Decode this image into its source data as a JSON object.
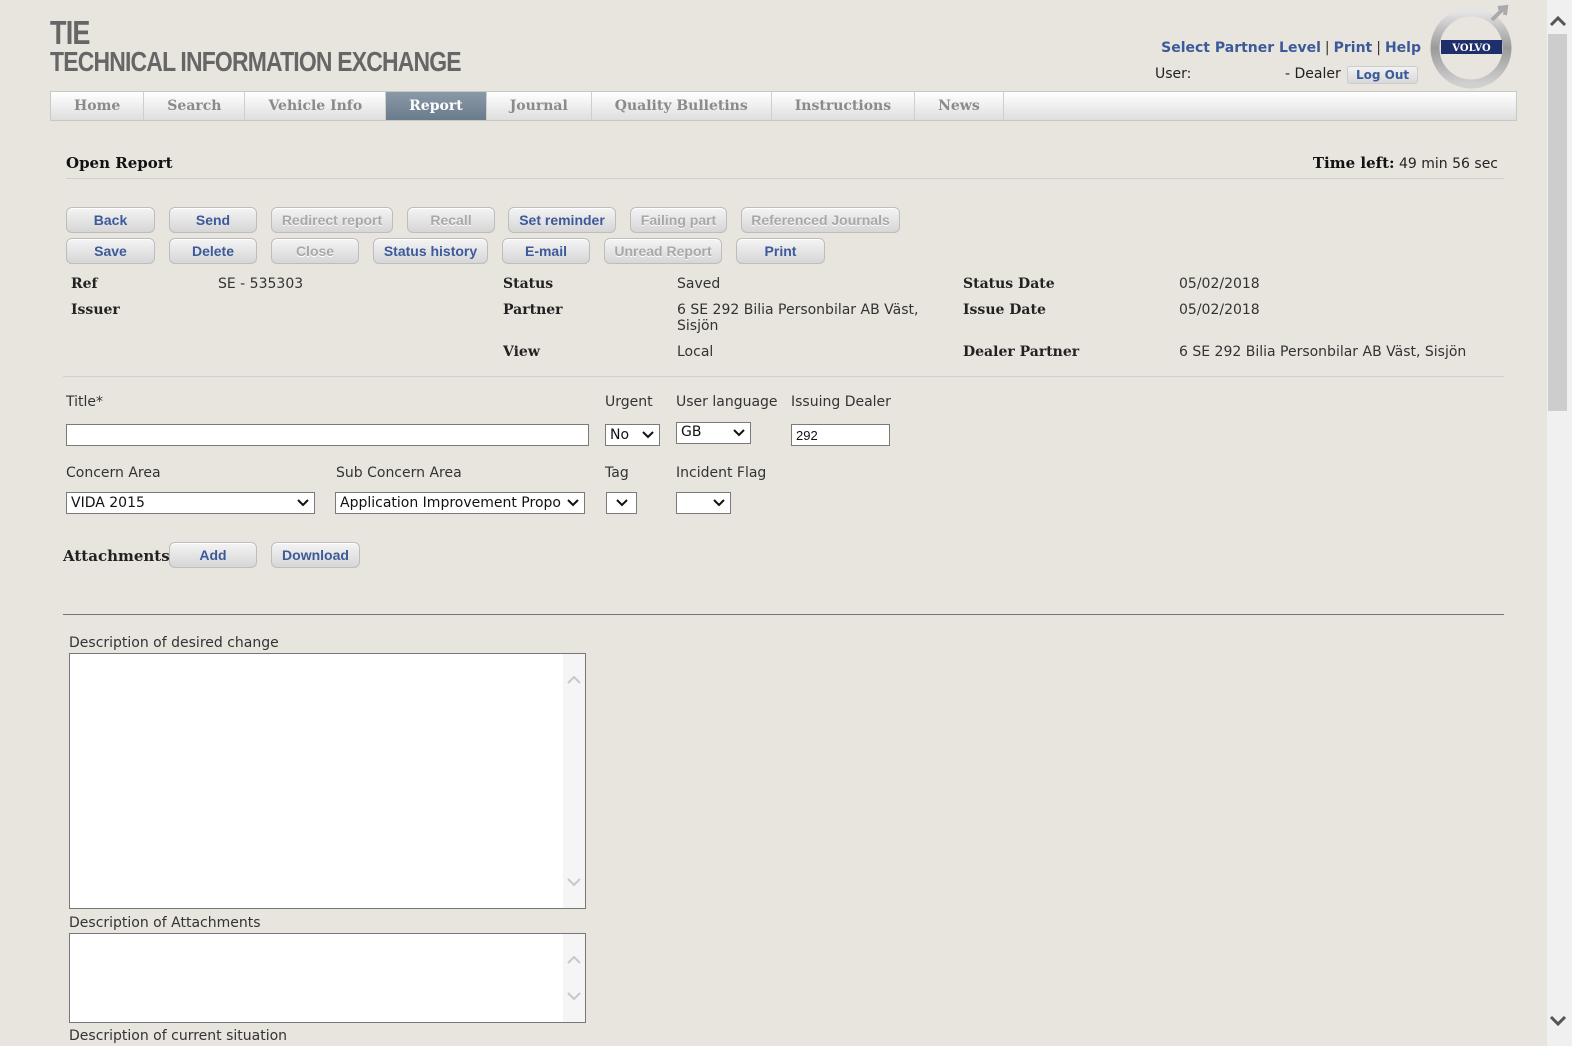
{
  "header": {
    "logo_line1": "TIE",
    "logo_line2": "TECHNICAL INFORMATION EXCHANGE",
    "links": [
      "Select Partner Level",
      "Print",
      "Help"
    ],
    "user_label": "User:",
    "user_role": "- Dealer",
    "logout_label": "Log Out",
    "brand_badge": "VOLVO"
  },
  "nav": {
    "tabs": [
      "Home",
      "Search",
      "Vehicle Info",
      "Report",
      "Journal",
      "Quality Bulletins",
      "Instructions",
      "News"
    ],
    "active": "Report"
  },
  "page": {
    "title": "Open Report",
    "time_left_label": "Time left:",
    "time_left_value": "49 min 56 sec"
  },
  "toolbar": {
    "row1": [
      {
        "label": "Back",
        "enabled": true
      },
      {
        "label": "Send",
        "enabled": true
      },
      {
        "label": "Redirect report",
        "enabled": false
      },
      {
        "label": "Recall",
        "enabled": false
      },
      {
        "label": "Set reminder",
        "enabled": true
      },
      {
        "label": "Failing part",
        "enabled": false
      },
      {
        "label": "Referenced Journals",
        "enabled": false
      }
    ],
    "row2": [
      {
        "label": "Save",
        "enabled": true
      },
      {
        "label": "Delete",
        "enabled": true
      },
      {
        "label": "Close",
        "enabled": false
      },
      {
        "label": "Status history",
        "enabled": true
      },
      {
        "label": "E-mail",
        "enabled": true
      },
      {
        "label": "Unread Report",
        "enabled": false
      },
      {
        "label": "Print",
        "enabled": true
      }
    ]
  },
  "info": {
    "ref_label": "Ref",
    "ref_value": "SE - 535303",
    "issuer_label": "Issuer",
    "issuer_value": "",
    "status_label": "Status",
    "status_value": "Saved",
    "partner_label": "Partner",
    "partner_value_line1": "6 SE 292 Bilia Personbilar AB Väst,",
    "partner_value_line2": "Sisjön",
    "view_label": "View",
    "view_value": "Local",
    "status_date_label": "Status Date",
    "status_date_value": "05/02/2018",
    "issue_date_label": "Issue Date",
    "issue_date_value": "05/02/2018",
    "dealer_partner_label": "Dealer Partner",
    "dealer_partner_value": "6 SE 292 Bilia Personbilar AB Väst, Sisjön"
  },
  "form": {
    "title_label": "Title*",
    "title_value": "",
    "urgent_label": "Urgent",
    "urgent_value": "No",
    "user_language_label": "User language",
    "user_language_value": "GB",
    "issuing_dealer_label": "Issuing Dealer",
    "issuing_dealer_value": "292",
    "concern_area_label": "Concern Area",
    "concern_area_value": "VIDA 2015",
    "sub_concern_area_label": "Sub Concern Area",
    "sub_concern_area_value": "Application Improvement Propo",
    "tag_label": "Tag",
    "tag_value": "",
    "incident_flag_label": "Incident Flag",
    "incident_flag_value": ""
  },
  "attachments": {
    "label": "Attachments",
    "add_label": "Add",
    "download_label": "Download"
  },
  "descriptions": {
    "desired_change_label": "Description of desired change",
    "desired_change_value": "",
    "attachments_desc_label": "Description of Attachments",
    "attachments_desc_value": "",
    "current_situation_label": "Description of current situation"
  },
  "colors": {
    "link": "#3c5a9a",
    "background": "#e8e5df",
    "active_tab": "#7a8a9a",
    "disabled_text": "#a8a8a8"
  }
}
